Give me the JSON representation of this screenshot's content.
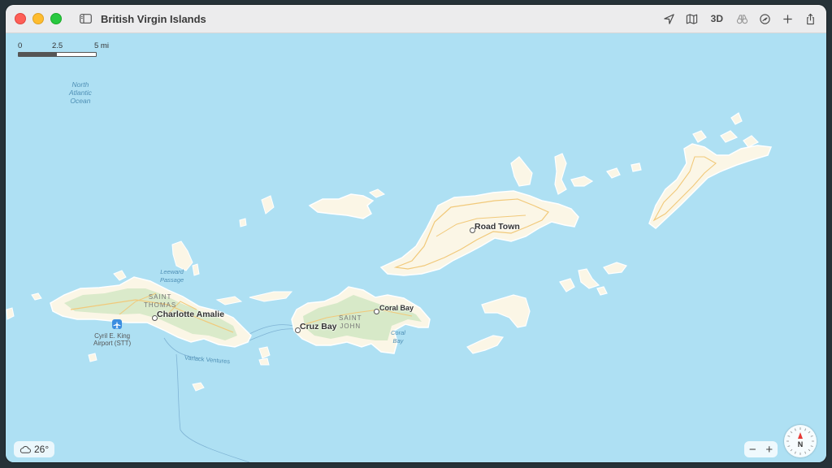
{
  "window": {
    "title": "British Virgin Islands"
  },
  "toolbar": {
    "three_d_label": "3D"
  },
  "scale": {
    "tick0": "0",
    "tick1": "2.5",
    "tick2": "5 mi"
  },
  "weather": {
    "temperature": "26°"
  },
  "zoom": {
    "minus": "−",
    "plus": "+"
  },
  "compass": {
    "north": "N"
  },
  "labels": {
    "ocean": [
      "North",
      "Atlantic",
      "Ocean"
    ],
    "leeward": [
      "Leeward",
      "Passage"
    ],
    "saint_thomas": [
      "SAINT",
      "THOMAS"
    ],
    "charlotte_amalie": "Charlotte Amalie",
    "airport": [
      "Cyril E. King",
      "Airport (STT)"
    ],
    "varlack": "Varlack Ventures",
    "saint_john": [
      "SAINT",
      "JOHN"
    ],
    "cruz_bay": "Cruz Bay",
    "coral_bay_town": "Coral Bay",
    "coral_bay_water": [
      "Coral",
      "Bay"
    ],
    "road_town": "Road Town"
  },
  "colors": {
    "sea": "#aee0f3",
    "land": "#fbf6e6",
    "park": "#d3e8c4",
    "road": "#f1c97a"
  }
}
